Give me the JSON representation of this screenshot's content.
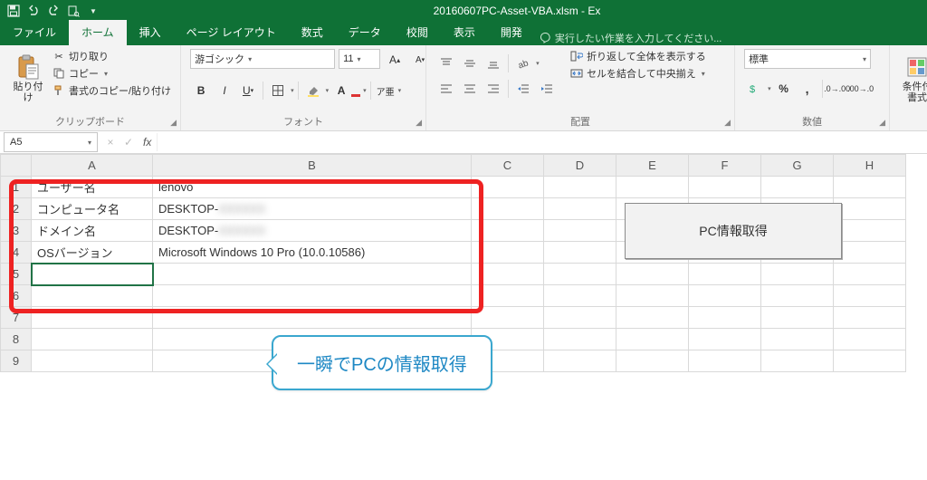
{
  "title": "20160607PC-Asset-VBA.xlsm - Ex",
  "qat": {
    "autosave": false
  },
  "tabs": {
    "file": "ファイル",
    "home": "ホーム",
    "insert": "挿入",
    "pagelayout": "ページ レイアウト",
    "formulas": "数式",
    "data": "データ",
    "review": "校閲",
    "view": "表示",
    "developer": "開発"
  },
  "tellme": "実行したい作業を入力してください...",
  "ribbon": {
    "clipboard": {
      "label": "クリップボード",
      "paste": "貼り付け",
      "cut": "切り取り",
      "copy": "コピー",
      "formatpainter": "書式のコピー/貼り付け"
    },
    "font": {
      "label": "フォント",
      "name": "游ゴシック",
      "size": "11"
    },
    "alignment": {
      "label": "配置",
      "wrap": "折り返して全体を表示する",
      "merge": "セルを結合して中央揃え"
    },
    "number": {
      "label": "数値",
      "format": "標準",
      "percent": "%",
      "comma": ","
    },
    "styles": {
      "label": "条件付書式"
    }
  },
  "namebox": "A5",
  "columns": [
    "A",
    "B",
    "C",
    "D",
    "E",
    "F",
    "G",
    "H"
  ],
  "rows": [
    "1",
    "2",
    "3",
    "4",
    "5",
    "6",
    "7",
    "8",
    "9"
  ],
  "cells": {
    "A1": "ユーザー名",
    "B1": "lenovo",
    "A2": "コンピュータ名",
    "B2": "DESKTOP-",
    "B2b": "XXXXXX",
    "A3": "ドメイン名",
    "B3": "DESKTOP-",
    "B3b": "XXXXXX",
    "A4": "OSバージョン",
    "B4": "Microsoft Windows 10 Pro (10.0.10586)"
  },
  "macroButton": "PC情報取得",
  "callout": "一瞬でPCの情報取得"
}
